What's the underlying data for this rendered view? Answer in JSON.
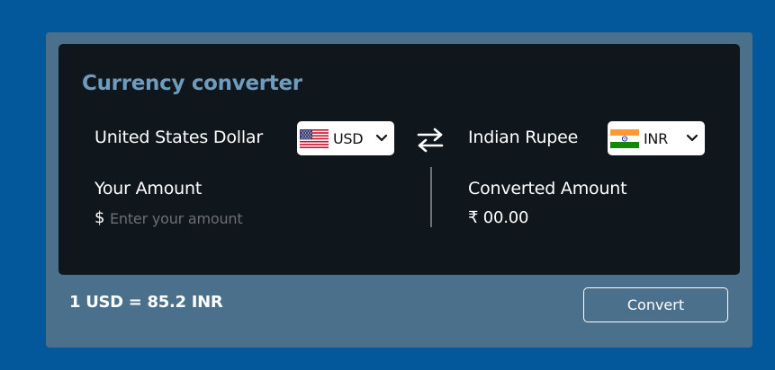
{
  "converter": {
    "title": "Currency converter",
    "from": {
      "name": "United States Dollar",
      "code": "USD",
      "flag": "us-flag-icon"
    },
    "to": {
      "name": "Indian Rupee",
      "code": "INR",
      "flag": "india-flag-icon"
    },
    "amount": {
      "label": "Your Amount",
      "symbol": "$",
      "placeholder": "Enter your amount",
      "value": ""
    },
    "converted": {
      "label": "Converted Amount",
      "value": "₹ 00.00"
    },
    "rate_text": "1 USD = 85.2 INR",
    "convert_label": "Convert"
  },
  "colors": {
    "page_bg": "#02589b",
    "card_bg": "#4b708b",
    "panel_bg": "#0f161c",
    "title": "#6f9bbd",
    "text": "#ffffff",
    "placeholder": "#6c7074"
  }
}
